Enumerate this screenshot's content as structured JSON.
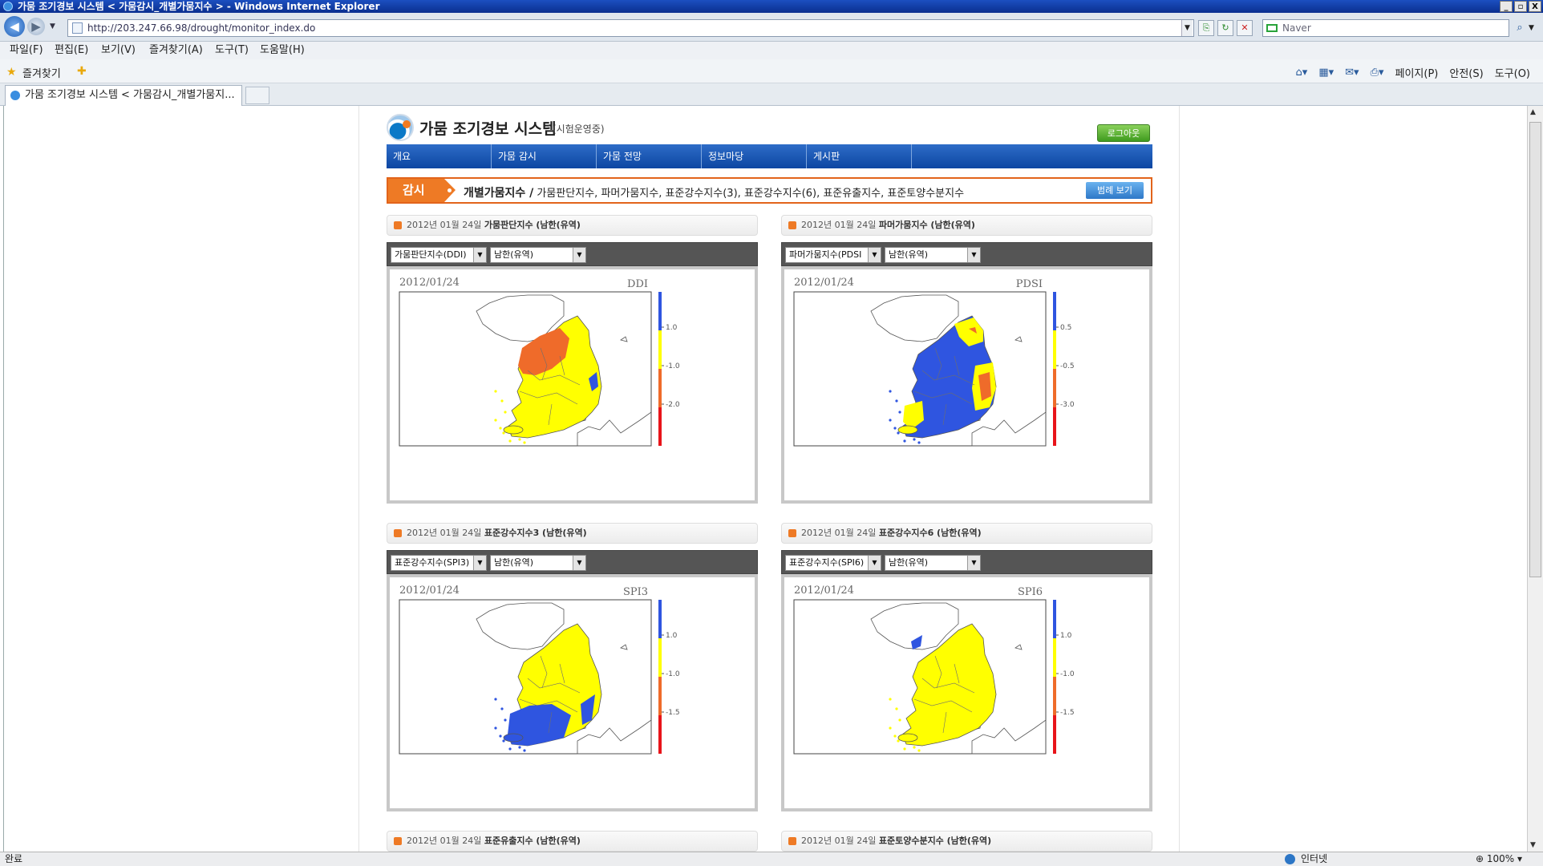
{
  "window": {
    "title": "가뭄 조기경보 시스템 < 가뭄감시_개별가뭄지수 > - Windows Internet Explorer",
    "controls": [
      "_",
      "▫",
      "X"
    ]
  },
  "address": {
    "url": "http://203.247.66.98/drought/monitor_index.do",
    "search_placeholder": "Naver"
  },
  "menu": [
    "파일(F)",
    "편집(E)",
    "보기(V)",
    "즐겨찾기(A)",
    "도구(T)",
    "도움말(H)"
  ],
  "favorites": {
    "label": "즐겨찾기"
  },
  "commandbar": [
    "페이지(P)",
    "안전(S)",
    "도구(O)"
  ],
  "tab": {
    "label": "가뭄 조기경보 시스템 < 가뭄감시_개별가뭄지..."
  },
  "statusbar": {
    "text": "완료",
    "zone": "인터넷",
    "zoom": "100%"
  },
  "site": {
    "title": "가뭄 조기경보 시스템",
    "subtitle": "(시험운영중)",
    "logout": "로그아웃",
    "nav": [
      "개요",
      "가뭄 감시",
      "가뭄 전망",
      "정보마당",
      "게시판",
      ""
    ],
    "crumb_tag": "감시",
    "crumb_head": "개별가뭄지수 /",
    "crumb_list": "가뭄판단지수, 파머가뭄지수, 표준강수지수(3), 표준강수지수(6), 표준유출지수, 표준토양수분지수",
    "legend_button": "범례 보기",
    "region_options": [
      "남한(유역)"
    ],
    "colors": {
      "wet": "#2f55e0",
      "normal": "#ffff00",
      "moderate": "#ef6b2a",
      "severe": "#e8141a"
    }
  },
  "panels": [
    {
      "date": "2012년 01월 24일",
      "index_title": "가뭄판단지수 (남한(유역)",
      "index_option": "가뭄판단지수(DDI)",
      "region": "남한(유역)",
      "map_date": "2012/01/24",
      "map_index": "DDI",
      "legend_ticks": [
        "1.0",
        "-1.0",
        "-2.0"
      ]
    },
    {
      "date": "2012년 01월 24일",
      "index_title": "파머가뭄지수 (남한(유역)",
      "index_option": "파머가뭄지수(PDSI",
      "region": "남한(유역)",
      "map_date": "2012/01/24",
      "map_index": "PDSI",
      "legend_ticks": [
        "0.5",
        "-0.5",
        "-3.0"
      ]
    },
    {
      "date": "2012년 01월 24일",
      "index_title": "표준강수지수3 (남한(유역)",
      "index_option": "표준강수지수(SPI3)",
      "region": "남한(유역)",
      "map_date": "2012/01/24",
      "map_index": "SPI3",
      "legend_ticks": [
        "1.0",
        "-1.0",
        "-1.5"
      ]
    },
    {
      "date": "2012년 01월 24일",
      "index_title": "표준강수지수6 (남한(유역)",
      "index_option": "표준강수지수(SPI6)",
      "region": "남한(유역)",
      "map_date": "2012/01/24",
      "map_index": "SPI6",
      "legend_ticks": [
        "1.0",
        "-1.0",
        "-1.5"
      ]
    },
    {
      "date": "2012년 01월 24일",
      "index_title": "표준유출지수 (남한(유역)"
    },
    {
      "date": "2012년 01월 24일",
      "index_title": "표준토양수분지수 (남한(유역)"
    }
  ]
}
